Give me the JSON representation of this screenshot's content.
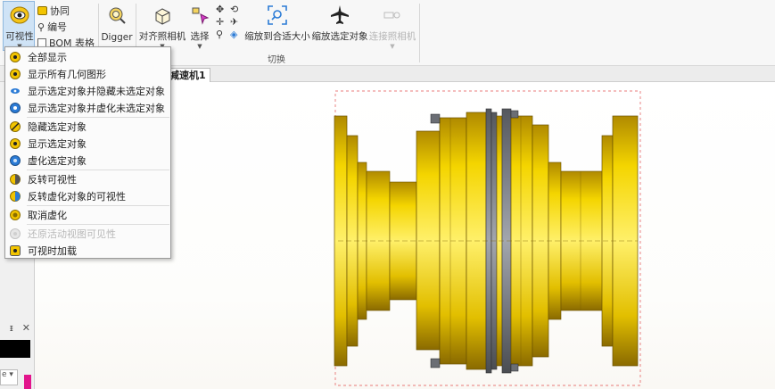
{
  "ribbon": {
    "visibility_label": "可视性",
    "collab_label": "协同",
    "numbering_label": "编号",
    "bom_label": "BOM 表格",
    "digger_label": "Digger",
    "align_camera_label": "对齐照相机",
    "select_label": "选择",
    "zoom_fit_label": "缩放到合适大小",
    "zoom_selected_label": "缩放选定对象",
    "connect_camera_label": "连接照相机",
    "switch_group_label": "切换"
  },
  "tabs": {
    "doc_tab_label": "减速机1"
  },
  "visibility_menu": {
    "items": [
      {
        "label": "全部显示",
        "icon": "eye-icon",
        "enabled": true
      },
      {
        "label": "显示所有几何图形",
        "icon": "eye-icon",
        "enabled": true
      },
      {
        "label": "显示选定对象并隐藏未选定对象",
        "icon": "eye-small-icon",
        "enabled": true
      },
      {
        "label": "显示选定对象并虚化未选定对象",
        "icon": "eye-ghost-icon",
        "enabled": true
      },
      {
        "label": "隐藏选定对象",
        "icon": "eye-off-icon",
        "enabled": true
      },
      {
        "label": "显示选定对象",
        "icon": "eye-icon",
        "enabled": true
      },
      {
        "label": "虚化选定对象",
        "icon": "ghost-icon",
        "enabled": true
      },
      {
        "label": "反转可视性",
        "icon": "eye-invert-icon",
        "enabled": true
      },
      {
        "label": "反转虚化对象的可视性",
        "icon": "ghost-invert-icon",
        "enabled": true
      },
      {
        "label": "取消虚化",
        "icon": "unghost-icon",
        "enabled": true
      },
      {
        "label": "还原活动视图可见性",
        "icon": "restore-visibility-icon",
        "enabled": false
      },
      {
        "label": "可视时加载",
        "icon": "load-visible-icon",
        "enabled": true
      }
    ]
  },
  "left_panel": {
    "pin_label": "ᵻ",
    "close_label": "✕",
    "dropdown_label": "e ▾"
  },
  "colors": {
    "model_gold": "#e8c400",
    "model_gold_dark": "#8a6a00",
    "ring_gray": "#7d8088",
    "menu_highlight": "#cfe3f6"
  }
}
